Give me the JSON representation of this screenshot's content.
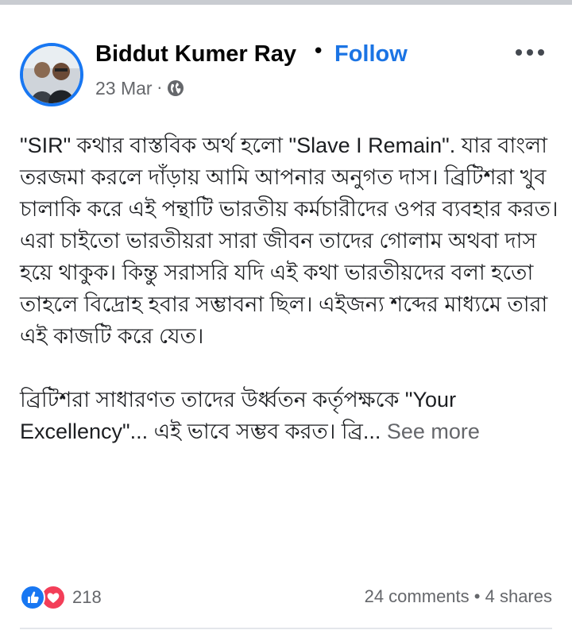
{
  "post": {
    "author": "Biddut Kumer Ray",
    "separator": "•",
    "follow_label": "Follow",
    "date": "23 Mar",
    "meta_dot": "·",
    "privacy_icon": "globe-icon",
    "more_icon": "more-horizontal-icon",
    "paragraphs": [
      "\"SIR\" কথার বাস্তবিক অর্থ হলো \"Slave I Remain\". যার বাংলা তরজমা করলে দাঁড়ায় আমি আপনার অনুগত দাস। ব্রিটিশরা খুব চালাকি করে এই পন্থাটি ভারতীয় কর্মচারীদের ওপর ব্যবহার করত। এরা চাইতো ভারতীয়রা সারা জীবন তাদের গোলাম অথবা দাস হয়ে থাকুক। কিন্তু সরাসরি যদি এই কথা ভারতীয়দের বলা হতো তাহলে বিদ্রোহ হবার সম্ভাবনা ছিল। এইজন্য শব্দের মাধ্যমে তারা এই কাজটি করে যেত।",
      "ব্রিটিশরা সাধারণত তাদের উর্ধ্বতন কর্তৃপক্ষকে \"Your Excellency\"... এই ভাবে সম্ভব করত। ব্রি..."
    ],
    "see_more_label": "See more"
  },
  "footer": {
    "reactions": [
      "like-reaction-icon",
      "love-reaction-icon"
    ],
    "reaction_count": "218",
    "comments": "24 comments",
    "stats_dot": "•",
    "shares": "4 shares"
  },
  "colors": {
    "accent": "#1b74e4",
    "secondary_text": "#65676b",
    "like": "#1877f2",
    "love": "#f33e58"
  }
}
